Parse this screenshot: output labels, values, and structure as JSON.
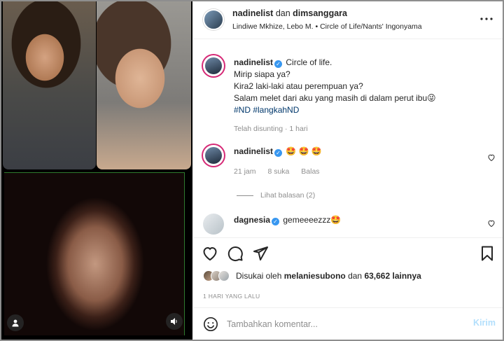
{
  "header": {
    "user1": "nadinelist",
    "connector": "dan",
    "user2": "dimsanggara",
    "audio": "Lindiwe Mkhize, Lebo M. • Circle of Life/Nants' Ingonyama",
    "more_icon": "more-horizontal-icon"
  },
  "caption": {
    "username": "nadinelist",
    "lines": [
      "Circle of life.",
      "Mirip siapa ya?",
      "Kira2 laki-laki atau perempuan ya?",
      "Salam melet dari aku yang masih di dalam perut ibu😜",
      "#ND #langkahND"
    ],
    "edited": "Telah disunting · 1 hari"
  },
  "comments": [
    {
      "username": "nadinelist",
      "text": "🤩 🤩 🤩",
      "time": "21 jam",
      "likes": "8 suka",
      "reply": "Balas",
      "view_replies": "Lihat balasan (2)"
    },
    {
      "username": "dagnesia",
      "text": "gemeeeezzz🤩"
    }
  ],
  "likes": {
    "prefix": "Disukai oleh",
    "user": "melaniesubono",
    "connector": "dan",
    "count": "63,662 lainnya"
  },
  "time_ago": "1 HARI YANG LALU",
  "add_comment": {
    "placeholder": "Tambahkan komentar...",
    "post_label": "Kirim"
  },
  "colors": {
    "verified": "#3897f0",
    "hashtag": "#00376b",
    "post_disabled": "#b2dffc",
    "meta_gray": "#8e8e8e"
  }
}
